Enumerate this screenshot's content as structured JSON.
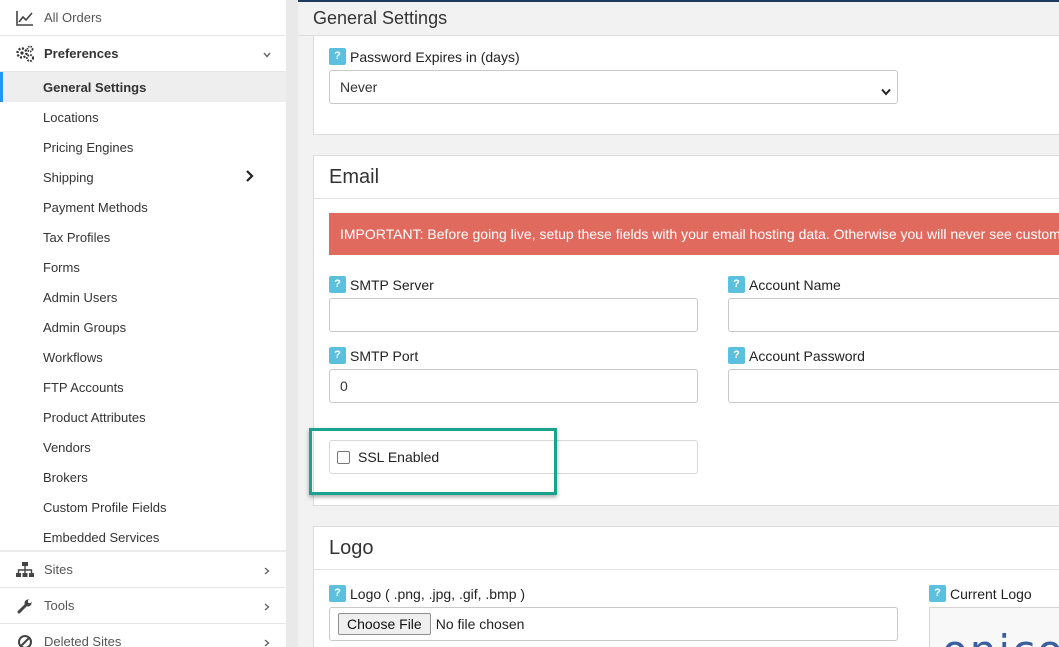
{
  "sidebar": {
    "all_orders": "All Orders",
    "preferences": "Preferences",
    "sub_items": [
      "General Settings",
      "Locations",
      "Pricing Engines",
      "Shipping",
      "Payment Methods",
      "Tax Profiles",
      "Forms",
      "Admin Users",
      "Admin Groups",
      "Workflows",
      "FTP Accounts",
      "Product Attributes",
      "Vendors",
      "Brokers",
      "Custom Profile Fields",
      "Embedded Services"
    ],
    "active_item": "General Settings",
    "sites": "Sites",
    "tools": "Tools",
    "deleted_sites": "Deleted Sites"
  },
  "main": {
    "page_title": "General Settings",
    "password_expires": {
      "label": "Password Expires in (days)",
      "value": "Never"
    },
    "email": {
      "heading": "Email",
      "alert": "IMPORTANT: Before going live, setup these fields with your email hosting data. Otherwise you will never see customers' emails",
      "smtp_server_label": "SMTP Server",
      "smtp_server_value": "",
      "account_name_label": "Account Name",
      "account_name_value": "",
      "smtp_port_label": "SMTP Port",
      "smtp_port_value": "0",
      "account_password_label": "Account Password",
      "account_password_value": "",
      "ssl_label": "SSL Enabled",
      "ssl_checked": false
    },
    "logo": {
      "heading": "Logo",
      "logo_label": "Logo ( .png, .jpg, .gif, .bmp )",
      "choose_file": "Choose File",
      "no_file": "No file chosen",
      "current_logo_label": "Current Logo",
      "current_logo_text": "onico"
    }
  },
  "colors": {
    "accent": "#2196f3",
    "alert_bg": "#e16a5e",
    "help_badge": "#5bc0de",
    "highlight": "#1aa38c"
  },
  "help_icon_text": "?"
}
